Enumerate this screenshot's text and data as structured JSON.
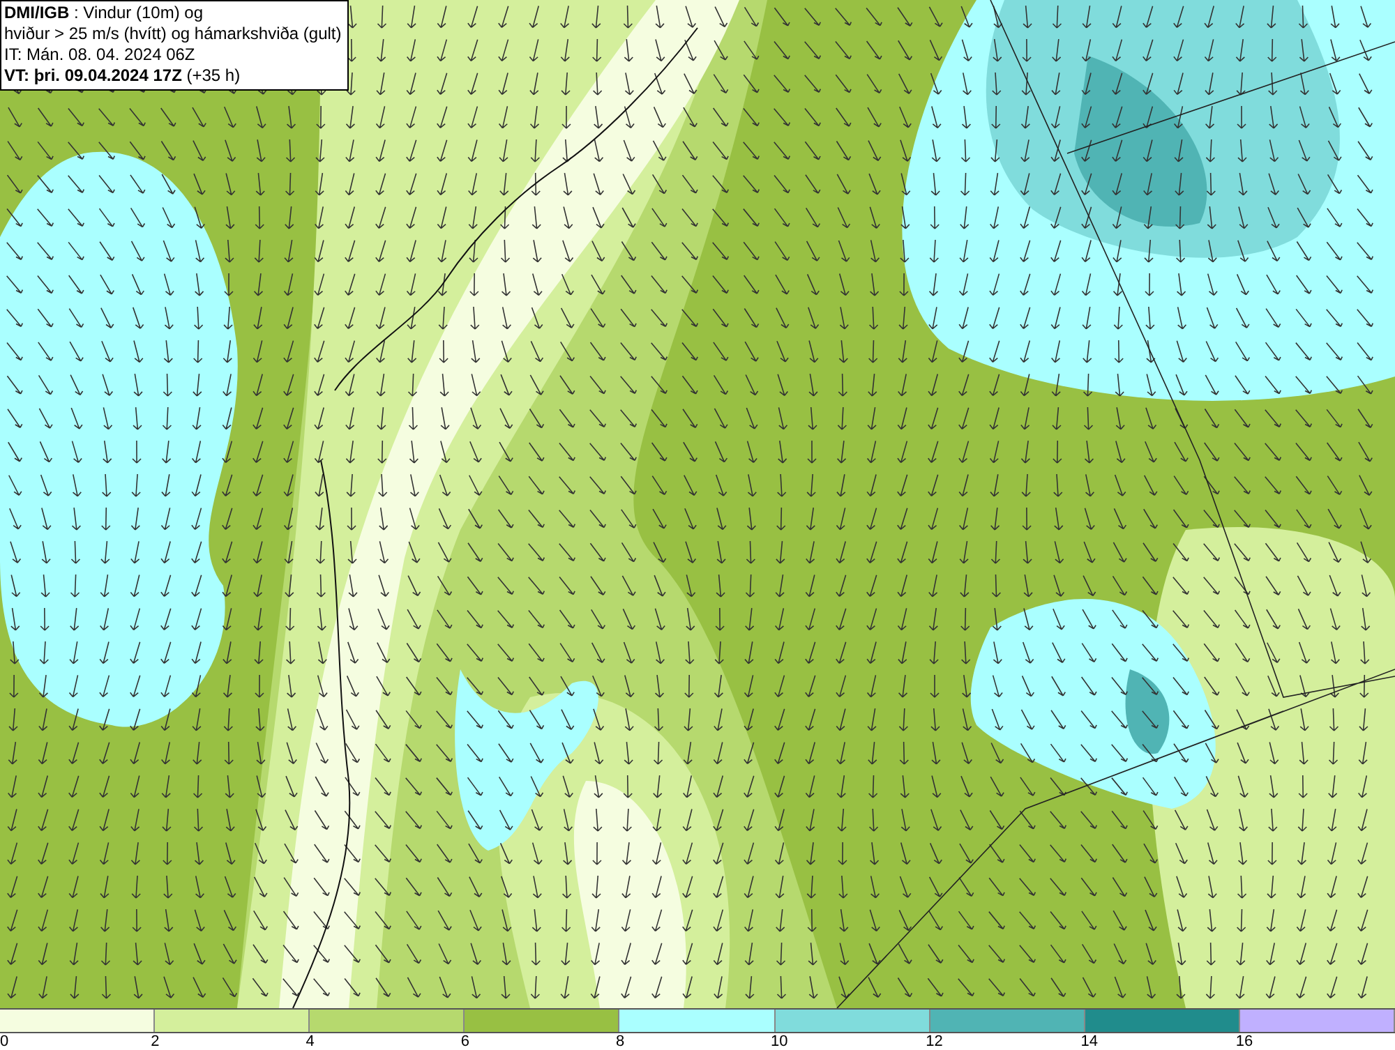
{
  "info_box": {
    "lines": [
      "**DMI/IGB** : Vindur (10m) og",
      "hviður > 25 m/s (hvítt) og hámarkshviða (gult)",
      "IT: Mán. 08. 04. 2024 06Z",
      "**VT: þri. 09.04.2024 17Z** (+35 h)"
    ]
  },
  "legend": {
    "segments": [
      {
        "label": "0",
        "color": "#f5fde0"
      },
      {
        "label": "2",
        "color": "#d4ef9c"
      },
      {
        "label": "4",
        "color": "#b6d96e"
      },
      {
        "label": "6",
        "color": "#98c043"
      },
      {
        "label": "8",
        "color": "#aaffff"
      },
      {
        "label": "10",
        "color": "#80dcdc"
      },
      {
        "label": "12",
        "color": "#50b4b4"
      },
      {
        "label": "14",
        "color": "#208c8c"
      },
      {
        "label": "16",
        "color": "#c0b0ff"
      }
    ]
  }
}
